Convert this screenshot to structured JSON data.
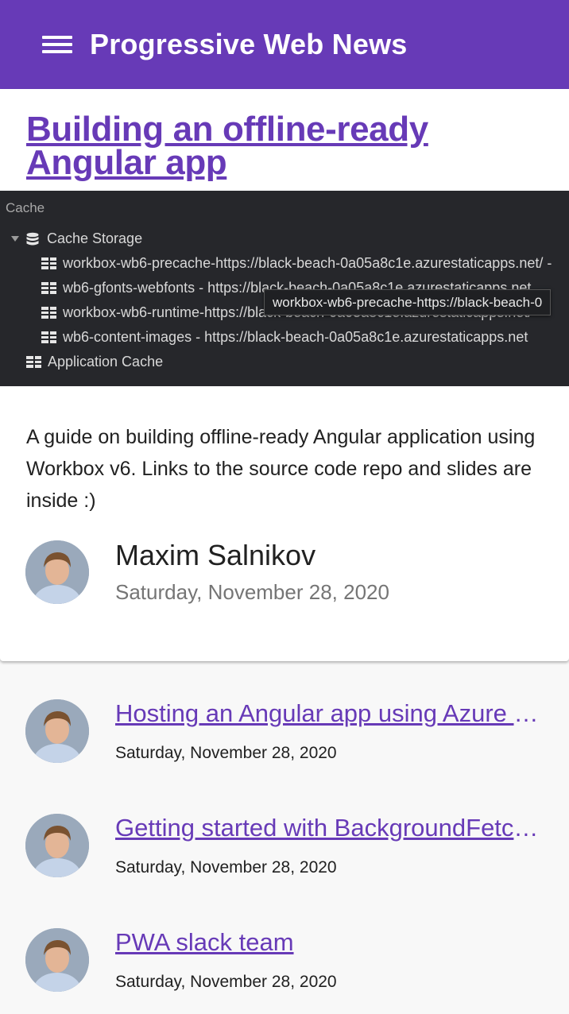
{
  "toolbar": {
    "title": "Progressive Web News",
    "menu_icon": "hamburger-menu-icon",
    "color": "#673ab7"
  },
  "featured": {
    "title": "Building an offline-ready Angular app",
    "image": {
      "header": "Cache",
      "cache_storage_label": "Cache Storage",
      "entries": [
        "workbox-wb6-precache-https://black-beach-0a05a8c1e.azurestaticapps.net/ -",
        "wb6-gfonts-webfonts - https://black-beach-0a05a8c1e.azurestaticapps.net",
        "workbox-wb6-runtime-https://black-beach-0a05a8c1e.azurestaticapps.net/",
        "wb6-content-images - https://black-beach-0a05a8c1e.azurestaticapps.net"
      ],
      "application_cache_label": "Application Cache",
      "tooltip": "workbox-wb6-precache-https://black-beach-0"
    },
    "description": "A guide on building offline-ready Angular application using Workbox v6. Links to the source code repo and slides are inside :)",
    "author": "Maxim Salnikov",
    "date": "Saturday, November 28, 2020"
  },
  "articles": [
    {
      "title": "Hosting an Angular app using Azure Static Web Apps",
      "date": "Saturday, November 28, 2020"
    },
    {
      "title": "Getting started with BackgroundFetch API",
      "date": "Saturday, November 28, 2020"
    },
    {
      "title": "PWA slack team",
      "date": "Saturday, November 28, 2020"
    }
  ]
}
